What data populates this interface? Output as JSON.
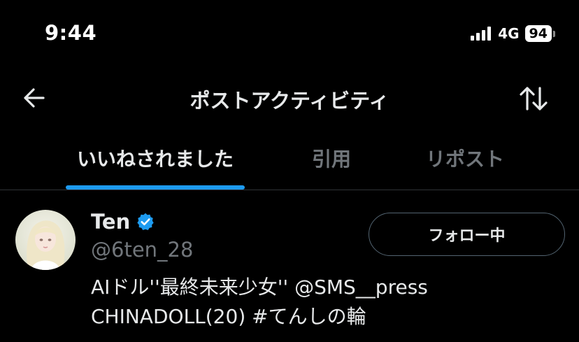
{
  "status_bar": {
    "time": "9:44",
    "network": "4G",
    "battery": "94"
  },
  "header": {
    "title": "ポストアクティビティ"
  },
  "tabs": [
    {
      "label": "いいねされました",
      "active": true
    },
    {
      "label": "引用",
      "active": false
    },
    {
      "label": "リポスト",
      "active": false
    }
  ],
  "user": {
    "display_name": "Ten",
    "username": "@6ten_28",
    "verified": true,
    "bio_line1": "AIドル''最終未来少女'' @SMS__press",
    "bio_line2": "CHINADOLL(20) #てんしの輪",
    "follow_label": "フォロー中"
  },
  "colors": {
    "accent": "#1d9bf0",
    "background": "#000000",
    "text_primary": "#e7e9ea",
    "text_secondary": "#71767b",
    "divider": "#2f3336"
  },
  "icons": {
    "back": "arrow-left-icon",
    "sort": "sort-arrows-icon",
    "verified": "verified-badge-icon"
  }
}
